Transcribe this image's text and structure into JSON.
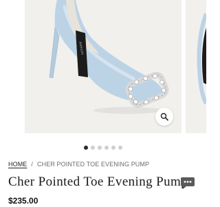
{
  "product_gallery": {
    "image_alt": "Light blue satin pointed toe pump with crystal buckle",
    "zoom_icon": "magnifier-icon",
    "slide_count": 6,
    "active_slide": 1
  },
  "breadcrumb": {
    "home": "HOME",
    "separator": "/",
    "current": "CHER POINTED TOE EVENING PUMP"
  },
  "product": {
    "title": "Cher Pointed Toe Evening Pump",
    "price": "$235.00"
  },
  "chat": {
    "icon": "chat-bubble-icon"
  },
  "colors": {
    "shoe": "#bcd3e5",
    "background": "#f1f0ed",
    "active_dot": "#2b2b2b",
    "inactive_dot": "#cfcfcf"
  }
}
